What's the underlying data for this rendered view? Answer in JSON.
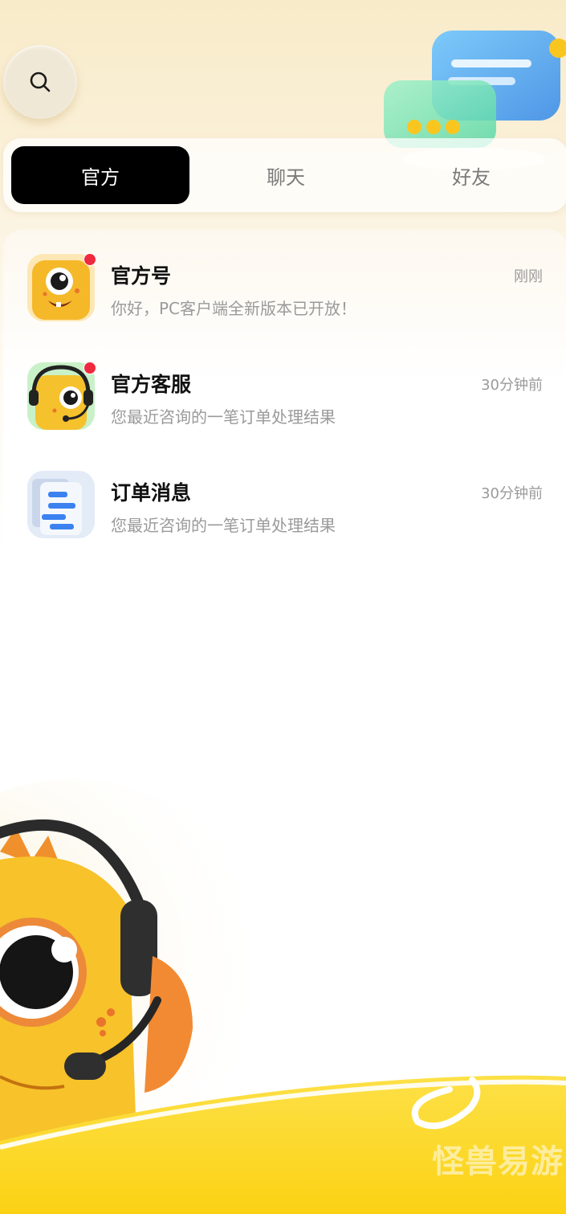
{
  "tabs": [
    {
      "label": "官方",
      "active": true
    },
    {
      "label": "聊天",
      "active": false
    },
    {
      "label": "好友",
      "active": false
    }
  ],
  "messages": [
    {
      "title": "官方号",
      "preview": "你好，PC客户端全新版本已开放！",
      "time": "刚刚",
      "unread": true,
      "avatar": "monster-avatar-icon"
    },
    {
      "title": "官方客服",
      "preview": "您最近咨询的一笔订单处理结果",
      "time": "30分钟前",
      "unread": true,
      "avatar": "headset-monster-avatar-icon"
    },
    {
      "title": "订单消息",
      "preview": "您最近咨询的一笔订单处理结果",
      "time": "30分钟前",
      "unread": false,
      "avatar": "document-icon"
    }
  ],
  "watermark": "怪兽易游",
  "colors": {
    "accent": "#000000",
    "unread_dot": "#ef2a3f",
    "brand_yellow": "#fbd51f",
    "background_top": "#f8ebc9"
  }
}
